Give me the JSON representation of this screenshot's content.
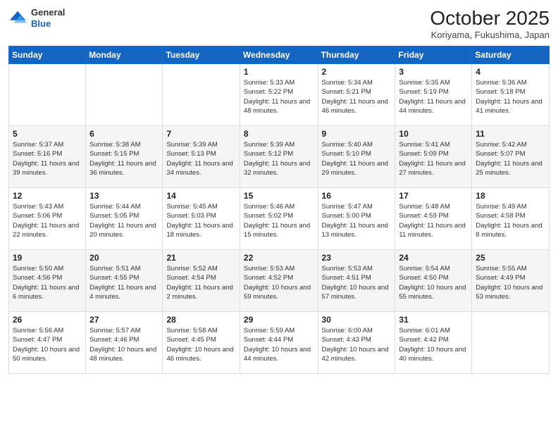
{
  "header": {
    "logo_general": "General",
    "logo_blue": "Blue",
    "month": "October 2025",
    "location": "Koriyama, Fukushima, Japan"
  },
  "weekdays": [
    "Sunday",
    "Monday",
    "Tuesday",
    "Wednesday",
    "Thursday",
    "Friday",
    "Saturday"
  ],
  "weeks": [
    [
      {
        "day": "",
        "sunrise": "",
        "sunset": "",
        "daylight": ""
      },
      {
        "day": "",
        "sunrise": "",
        "sunset": "",
        "daylight": ""
      },
      {
        "day": "",
        "sunrise": "",
        "sunset": "",
        "daylight": ""
      },
      {
        "day": "1",
        "sunrise": "Sunrise: 5:33 AM",
        "sunset": "Sunset: 5:22 PM",
        "daylight": "Daylight: 11 hours and 48 minutes."
      },
      {
        "day": "2",
        "sunrise": "Sunrise: 5:34 AM",
        "sunset": "Sunset: 5:21 PM",
        "daylight": "Daylight: 11 hours and 46 minutes."
      },
      {
        "day": "3",
        "sunrise": "Sunrise: 5:35 AM",
        "sunset": "Sunset: 5:19 PM",
        "daylight": "Daylight: 11 hours and 44 minutes."
      },
      {
        "day": "4",
        "sunrise": "Sunrise: 5:36 AM",
        "sunset": "Sunset: 5:18 PM",
        "daylight": "Daylight: 11 hours and 41 minutes."
      }
    ],
    [
      {
        "day": "5",
        "sunrise": "Sunrise: 5:37 AM",
        "sunset": "Sunset: 5:16 PM",
        "daylight": "Daylight: 11 hours and 39 minutes."
      },
      {
        "day": "6",
        "sunrise": "Sunrise: 5:38 AM",
        "sunset": "Sunset: 5:15 PM",
        "daylight": "Daylight: 11 hours and 36 minutes."
      },
      {
        "day": "7",
        "sunrise": "Sunrise: 5:39 AM",
        "sunset": "Sunset: 5:13 PM",
        "daylight": "Daylight: 11 hours and 34 minutes."
      },
      {
        "day": "8",
        "sunrise": "Sunrise: 5:39 AM",
        "sunset": "Sunset: 5:12 PM",
        "daylight": "Daylight: 11 hours and 32 minutes."
      },
      {
        "day": "9",
        "sunrise": "Sunrise: 5:40 AM",
        "sunset": "Sunset: 5:10 PM",
        "daylight": "Daylight: 11 hours and 29 minutes."
      },
      {
        "day": "10",
        "sunrise": "Sunrise: 5:41 AM",
        "sunset": "Sunset: 5:09 PM",
        "daylight": "Daylight: 11 hours and 27 minutes."
      },
      {
        "day": "11",
        "sunrise": "Sunrise: 5:42 AM",
        "sunset": "Sunset: 5:07 PM",
        "daylight": "Daylight: 11 hours and 25 minutes."
      }
    ],
    [
      {
        "day": "12",
        "sunrise": "Sunrise: 5:43 AM",
        "sunset": "Sunset: 5:06 PM",
        "daylight": "Daylight: 11 hours and 22 minutes."
      },
      {
        "day": "13",
        "sunrise": "Sunrise: 5:44 AM",
        "sunset": "Sunset: 5:05 PM",
        "daylight": "Daylight: 11 hours and 20 minutes."
      },
      {
        "day": "14",
        "sunrise": "Sunrise: 5:45 AM",
        "sunset": "Sunset: 5:03 PM",
        "daylight": "Daylight: 11 hours and 18 minutes."
      },
      {
        "day": "15",
        "sunrise": "Sunrise: 5:46 AM",
        "sunset": "Sunset: 5:02 PM",
        "daylight": "Daylight: 11 hours and 15 minutes."
      },
      {
        "day": "16",
        "sunrise": "Sunrise: 5:47 AM",
        "sunset": "Sunset: 5:00 PM",
        "daylight": "Daylight: 11 hours and 13 minutes."
      },
      {
        "day": "17",
        "sunrise": "Sunrise: 5:48 AM",
        "sunset": "Sunset: 4:59 PM",
        "daylight": "Daylight: 11 hours and 11 minutes."
      },
      {
        "day": "18",
        "sunrise": "Sunrise: 5:49 AM",
        "sunset": "Sunset: 4:58 PM",
        "daylight": "Daylight: 11 hours and 8 minutes."
      }
    ],
    [
      {
        "day": "19",
        "sunrise": "Sunrise: 5:50 AM",
        "sunset": "Sunset: 4:56 PM",
        "daylight": "Daylight: 11 hours and 6 minutes."
      },
      {
        "day": "20",
        "sunrise": "Sunrise: 5:51 AM",
        "sunset": "Sunset: 4:55 PM",
        "daylight": "Daylight: 11 hours and 4 minutes."
      },
      {
        "day": "21",
        "sunrise": "Sunrise: 5:52 AM",
        "sunset": "Sunset: 4:54 PM",
        "daylight": "Daylight: 11 hours and 2 minutes."
      },
      {
        "day": "22",
        "sunrise": "Sunrise: 5:53 AM",
        "sunset": "Sunset: 4:52 PM",
        "daylight": "Daylight: 10 hours and 59 minutes."
      },
      {
        "day": "23",
        "sunrise": "Sunrise: 5:53 AM",
        "sunset": "Sunset: 4:51 PM",
        "daylight": "Daylight: 10 hours and 57 minutes."
      },
      {
        "day": "24",
        "sunrise": "Sunrise: 5:54 AM",
        "sunset": "Sunset: 4:50 PM",
        "daylight": "Daylight: 10 hours and 55 minutes."
      },
      {
        "day": "25",
        "sunrise": "Sunrise: 5:55 AM",
        "sunset": "Sunset: 4:49 PM",
        "daylight": "Daylight: 10 hours and 53 minutes."
      }
    ],
    [
      {
        "day": "26",
        "sunrise": "Sunrise: 5:56 AM",
        "sunset": "Sunset: 4:47 PM",
        "daylight": "Daylight: 10 hours and 50 minutes."
      },
      {
        "day": "27",
        "sunrise": "Sunrise: 5:57 AM",
        "sunset": "Sunset: 4:46 PM",
        "daylight": "Daylight: 10 hours and 48 minutes."
      },
      {
        "day": "28",
        "sunrise": "Sunrise: 5:58 AM",
        "sunset": "Sunset: 4:45 PM",
        "daylight": "Daylight: 10 hours and 46 minutes."
      },
      {
        "day": "29",
        "sunrise": "Sunrise: 5:59 AM",
        "sunset": "Sunset: 4:44 PM",
        "daylight": "Daylight: 10 hours and 44 minutes."
      },
      {
        "day": "30",
        "sunrise": "Sunrise: 6:00 AM",
        "sunset": "Sunset: 4:43 PM",
        "daylight": "Daylight: 10 hours and 42 minutes."
      },
      {
        "day": "31",
        "sunrise": "Sunrise: 6:01 AM",
        "sunset": "Sunset: 4:42 PM",
        "daylight": "Daylight: 10 hours and 40 minutes."
      },
      {
        "day": "",
        "sunrise": "",
        "sunset": "",
        "daylight": ""
      }
    ]
  ]
}
